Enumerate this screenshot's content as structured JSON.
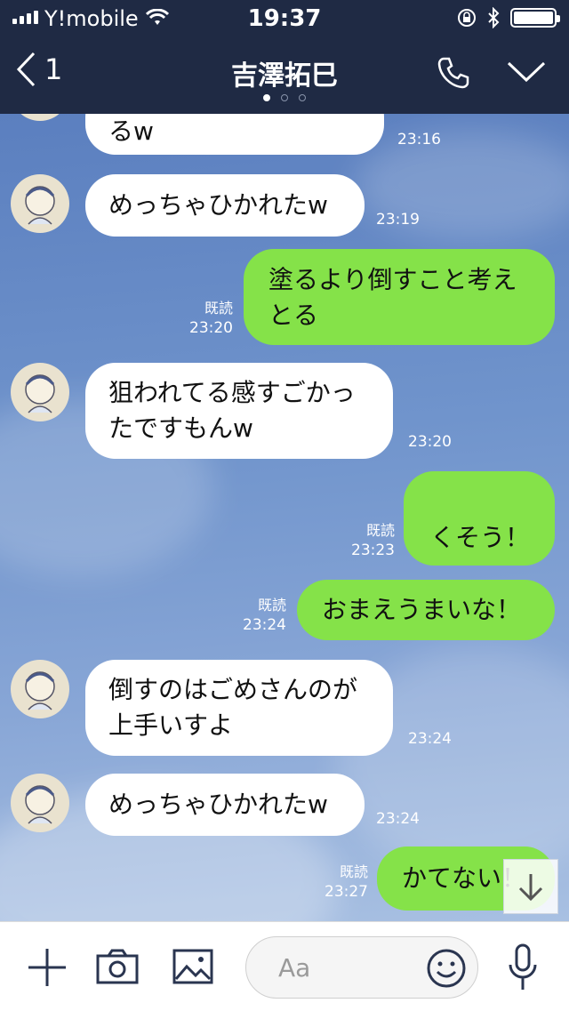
{
  "status": {
    "carrier": "Y!mobile",
    "time": "19:37"
  },
  "nav": {
    "back_count": "1",
    "title": "吉澤拓巳"
  },
  "messages": [
    {
      "side": "in",
      "lines": [
        "るw"
      ],
      "time": "23:16"
    },
    {
      "side": "in",
      "lines": [
        "めっちゃひかれたw"
      ],
      "time": "23:19"
    },
    {
      "side": "out",
      "lines": [
        "塗るより倒すこと考え",
        "とる"
      ],
      "read": "既読",
      "time": "23:20"
    },
    {
      "side": "in",
      "lines": [
        "狙われてる感すごかっ",
        "たですもんw"
      ],
      "time": "23:20"
    },
    {
      "side": "out",
      "lines": [
        "くそう！"
      ],
      "read": "既読",
      "time": "23:23"
    },
    {
      "side": "out",
      "lines": [
        "おまえうまいな！"
      ],
      "read": "既読",
      "time": "23:24"
    },
    {
      "side": "in",
      "lines": [
        "倒すのはごめさんのが",
        "上手いすよ"
      ],
      "time": "23:24"
    },
    {
      "side": "in",
      "lines": [
        "めっちゃひかれたw"
      ],
      "time": "23:24"
    },
    {
      "side": "out",
      "lines": [
        "かてない！"
      ],
      "read": "既読",
      "time": "23:27"
    }
  ],
  "input": {
    "placeholder": "Aa"
  },
  "icons": [
    "signal-icon",
    "wifi-icon",
    "lock-rotation-icon",
    "bluetooth-icon",
    "battery-icon",
    "back-chevron-icon",
    "phone-icon",
    "chevron-down-icon",
    "plus-icon",
    "camera-icon",
    "image-icon",
    "emoji-icon",
    "microphone-icon",
    "arrow-down-icon"
  ],
  "colors": {
    "header": "#1f2a44",
    "bubble_out": "#85e249",
    "bubble_in": "#ffffff",
    "chat_bg": "#6e8fc4"
  }
}
